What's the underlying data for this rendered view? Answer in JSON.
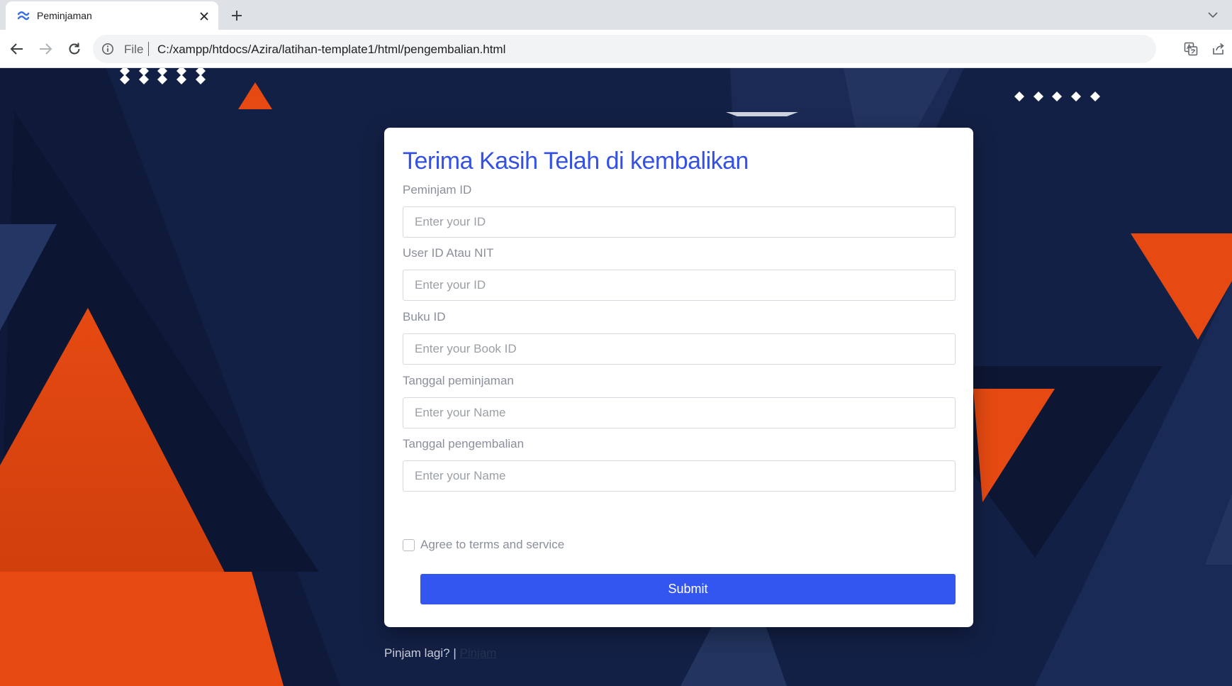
{
  "browser": {
    "tab_title": "Peminjaman",
    "omnibox_scheme": "File",
    "url": "C:/xampp/htdocs/Azira/latihan-template1/html/pengembalian.html"
  },
  "form": {
    "title": "Terima Kasih Telah di kembalikan",
    "fields": [
      {
        "label": "Peminjam ID",
        "placeholder": "Enter your ID",
        "value": ""
      },
      {
        "label": "User ID Atau NIT",
        "placeholder": "Enter your ID",
        "value": ""
      },
      {
        "label": "Buku ID",
        "placeholder": "Enter your Book ID",
        "value": ""
      },
      {
        "label": "Tanggal peminjaman",
        "placeholder": "Enter your Name",
        "value": ""
      },
      {
        "label": "Tanggal pengembalian",
        "placeholder": "Enter your Name",
        "value": ""
      }
    ],
    "terms_label": "Agree to terms and service",
    "terms_checked": false,
    "submit_label": "Submit"
  },
  "footer": {
    "text": "Pinjam lagi? |",
    "link_label": "Pinjam"
  },
  "colors": {
    "background_navy": "#132045",
    "accent_orange": "#e64a12",
    "title_blue": "#3451e6",
    "button_blue": "#3456f0"
  }
}
